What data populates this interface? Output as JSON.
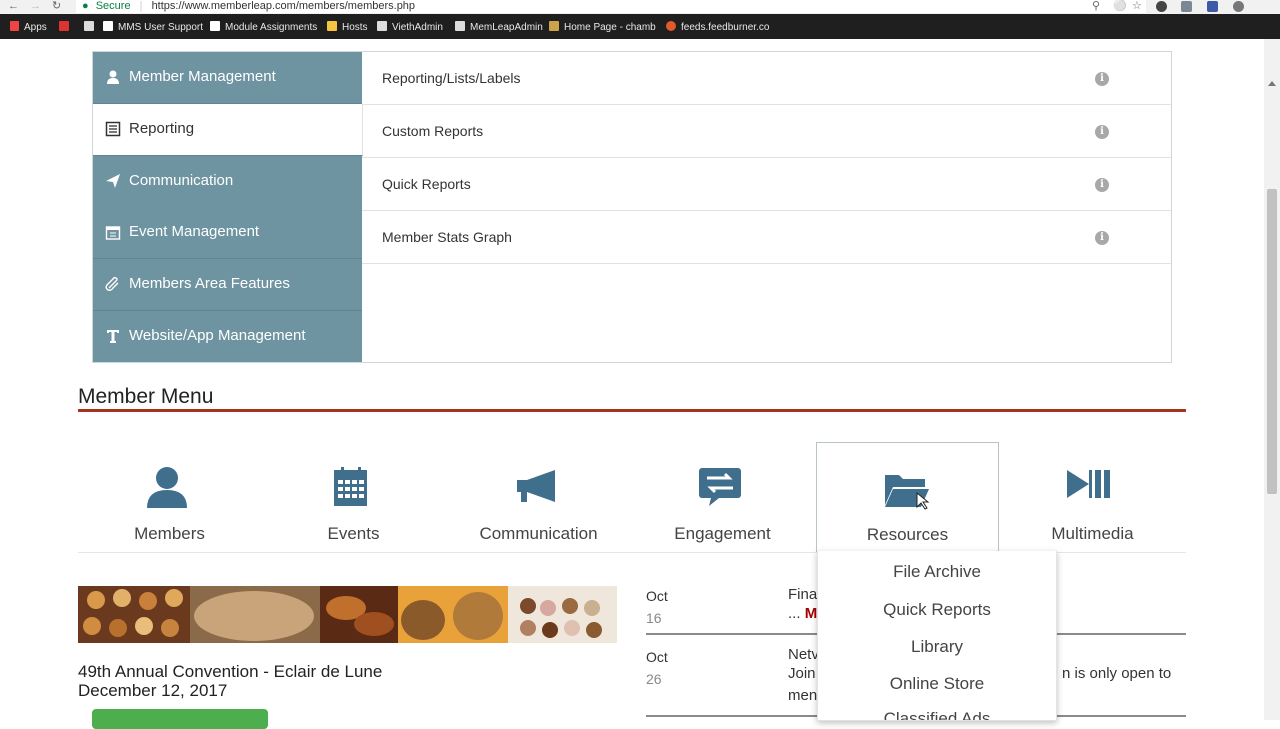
{
  "browser": {
    "secure_label": "Secure",
    "url": "https://www.memberleap.com/members/members.php",
    "bookmarks": [
      "Apps",
      "MMS User Support",
      "Module Assignments",
      "Hosts",
      "ViethAdmin",
      "MemLeapAdmin",
      "Home Page - chamb",
      "feeds.feedburner.co"
    ]
  },
  "admin": {
    "sidebar": [
      {
        "label": "Member Management",
        "icon": "user-icon"
      },
      {
        "label": "Reporting",
        "icon": "list-icon"
      },
      {
        "label": "Communication",
        "icon": "paper-plane-icon"
      },
      {
        "label": "Event Management",
        "icon": "calendar-icon"
      },
      {
        "label": "Members Area Features",
        "icon": "paperclip-icon"
      },
      {
        "label": "Website/App Management",
        "icon": "text-icon"
      }
    ],
    "items": [
      {
        "label": "Reporting/Lists/Labels"
      },
      {
        "label": "Custom Reports"
      },
      {
        "label": "Quick Reports"
      },
      {
        "label": "Member Stats Graph"
      }
    ]
  },
  "member_menu": {
    "title": "Member Menu",
    "tiles": [
      {
        "label": "Members",
        "icon": "member-icon"
      },
      {
        "label": "Events",
        "icon": "calendar-icon"
      },
      {
        "label": "Communication",
        "icon": "megaphone-icon"
      },
      {
        "label": "Engagement",
        "icon": "exchange-icon"
      },
      {
        "label": "Resources",
        "icon": "folder-open-icon"
      },
      {
        "label": "Multimedia",
        "icon": "play-pause-icon"
      }
    ],
    "dropdown": [
      "File Archive",
      "Quick Reports",
      "Library",
      "Online Store",
      "Classified Ads"
    ]
  },
  "event": {
    "title": "49th Annual Convention - Eclair de Lune",
    "date": "December 12, 2017"
  },
  "news": [
    {
      "month": "Oct",
      "day": "16",
      "title": "Fina",
      "snippet": "...",
      "more": "M"
    },
    {
      "month": "Oct",
      "day": "26",
      "title": "Netv",
      "line1": "Join",
      "line2": "men",
      "tail": "n is only open to"
    }
  ],
  "colors": {
    "sidebar": "#6e93a1",
    "accent_rule": "#a5341f",
    "button_green": "#4cae4c"
  }
}
